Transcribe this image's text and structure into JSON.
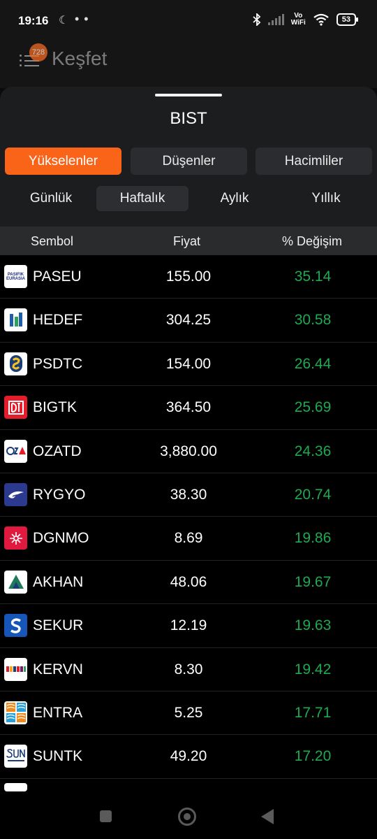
{
  "status_bar": {
    "time": "19:16",
    "moon_icon": "☾",
    "dots": "• •",
    "battery": "53",
    "vowifi_top": "Vo",
    "vowifi_bottom": "WiFi"
  },
  "app_header": {
    "title": "Keşfet",
    "badge": "728"
  },
  "sheet": {
    "title": "BIST",
    "main_tabs": [
      "Yükselenler",
      "Düşenler",
      "Hacimliler"
    ],
    "active_main_tab": "Yükselenler",
    "period_tabs": [
      "Günlük",
      "Haftalık",
      "Aylık",
      "Yıllık"
    ],
    "active_period_tab": "Haftalık",
    "columns": [
      "Sembol",
      "Fiyat",
      "% Değişim"
    ]
  },
  "rows": [
    {
      "symbol": "PASEU",
      "price": "155.00",
      "change": "35.14",
      "logo": "paseu-logo-icon"
    },
    {
      "symbol": "HEDEF",
      "price": "304.25",
      "change": "30.58",
      "logo": "hedef-logo-icon"
    },
    {
      "symbol": "PSDTC",
      "price": "154.00",
      "change": "26.44",
      "logo": "psdtc-logo-icon"
    },
    {
      "symbol": "BIGTK",
      "price": "364.50",
      "change": "25.69",
      "logo": "bigtk-logo-icon"
    },
    {
      "symbol": "OZATD",
      "price": "3,880.00",
      "change": "24.36",
      "logo": "ozatd-logo-icon"
    },
    {
      "symbol": "RYGYO",
      "price": "38.30",
      "change": "20.74",
      "logo": "rygyo-logo-icon"
    },
    {
      "symbol": "DGNMO",
      "price": "8.69",
      "change": "19.86",
      "logo": "dgnmo-logo-icon"
    },
    {
      "symbol": "AKHAN",
      "price": "48.06",
      "change": "19.67",
      "logo": "akhan-logo-icon"
    },
    {
      "symbol": "SEKUR",
      "price": "12.19",
      "change": "19.63",
      "logo": "sekur-logo-icon"
    },
    {
      "symbol": "KERVN",
      "price": "8.30",
      "change": "19.42",
      "logo": "kervn-logo-icon"
    },
    {
      "symbol": "ENTRA",
      "price": "5.25",
      "change": "17.71",
      "logo": "entra-logo-icon"
    },
    {
      "symbol": "SUNTK",
      "price": "49.20",
      "change": "17.20",
      "logo": "suntk-logo-icon"
    }
  ],
  "colors": {
    "accent": "#fa6419",
    "positive": "#1faa4f",
    "sheet_bg": "#1c1d1f"
  }
}
